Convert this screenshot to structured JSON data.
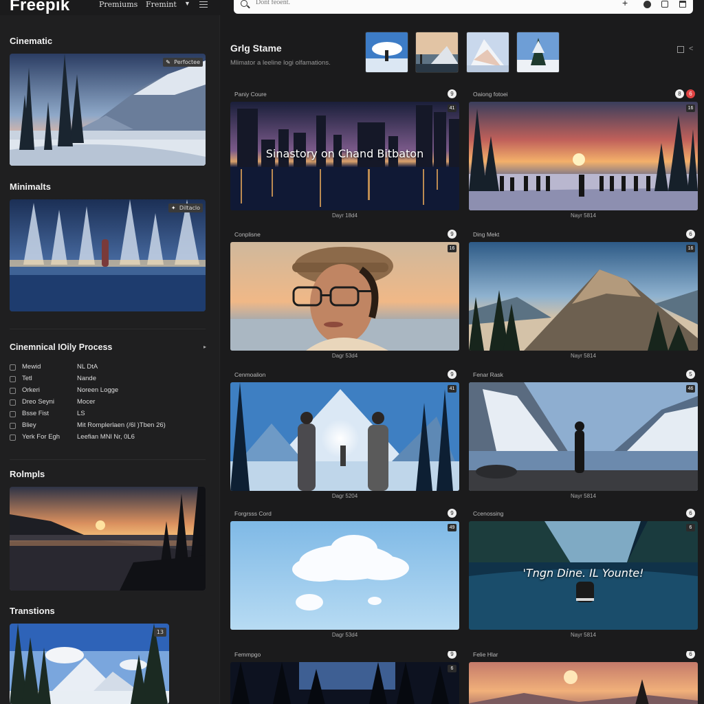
{
  "topbar": {
    "logo": "Freepik",
    "nav": [
      "Premiums",
      "Fremint"
    ],
    "search_placeholder": "Dont feoent."
  },
  "sidebar": {
    "sections": [
      {
        "title": "Cinematic",
        "tag": "Perfoctee"
      },
      {
        "title": "Minimalts",
        "tag": "Diltaclo"
      }
    ],
    "filters": {
      "title": "Cinemnical IOily Process",
      "rows": [
        {
          "label": "Mewid",
          "value": "NL DtA"
        },
        {
          "label": "Tetl",
          "value": "Nande"
        },
        {
          "label": "Orkeri",
          "value": "Noreen Logge"
        },
        {
          "label": "Dreo Seyni",
          "value": "Mocer"
        },
        {
          "label": "Bsse Fist",
          "value": "LS"
        },
        {
          "label": "Bliey",
          "value": "Mit Romplerlaen (/6l )Tben 26)"
        },
        {
          "label": "Yerk For Egh",
          "value": "Leefian MNl Nr, 0L6"
        }
      ]
    },
    "section3": {
      "title": "Rolmpls"
    },
    "section4": {
      "title": "Transtions",
      "tag": "13"
    }
  },
  "main": {
    "title": "Grlg Stame",
    "subtitle": "Mlimator a leeline logi olfamations.",
    "cards": [
      {
        "label": "Paniy Coure",
        "caption": "Dayr 18d4",
        "overlay": "Sinastory on Chand Bitbaton",
        "badge": "9",
        "corner": "41"
      },
      {
        "label": "Oaiong fotoei",
        "caption": "Nayr 5814",
        "overlay": "",
        "badge": "6",
        "badge2": "8",
        "corner": "16"
      },
      {
        "label": "Conplisne",
        "caption": "Dagr 53d4",
        "overlay": "",
        "badge": "9",
        "corner": "16"
      },
      {
        "label": "Ding Mekt",
        "caption": "Nayr 5814",
        "overlay": "",
        "badge": "6",
        "corner": "16"
      },
      {
        "label": "Cenmoalion",
        "caption": "Dagr 5204",
        "overlay": "",
        "badge": "9",
        "corner": "41"
      },
      {
        "label": "Fenar Rask",
        "caption": "Nayr 5814",
        "overlay": "",
        "badge": "5",
        "corner": "46"
      },
      {
        "label": "Forgrsss Cord",
        "caption": "Dagr 53d4",
        "overlay": "",
        "badge": "9",
        "corner": "49"
      },
      {
        "label": "Ccenossing",
        "caption": "Nayr 5814",
        "overlay": "'Tngn Dine. IL Younte!",
        "badge": "6",
        "corner": "6"
      },
      {
        "label": "Femmpgo",
        "caption": "",
        "overlay": "",
        "badge": "9",
        "corner": "6"
      },
      {
        "label": "Felie Hlar",
        "caption": "",
        "overlay": "",
        "badge": "6",
        "corner": ""
      }
    ]
  },
  "colors": {
    "bg": "#1b1b1c",
    "sidebar": "#1f1f20",
    "accent_red": "#e04343"
  }
}
